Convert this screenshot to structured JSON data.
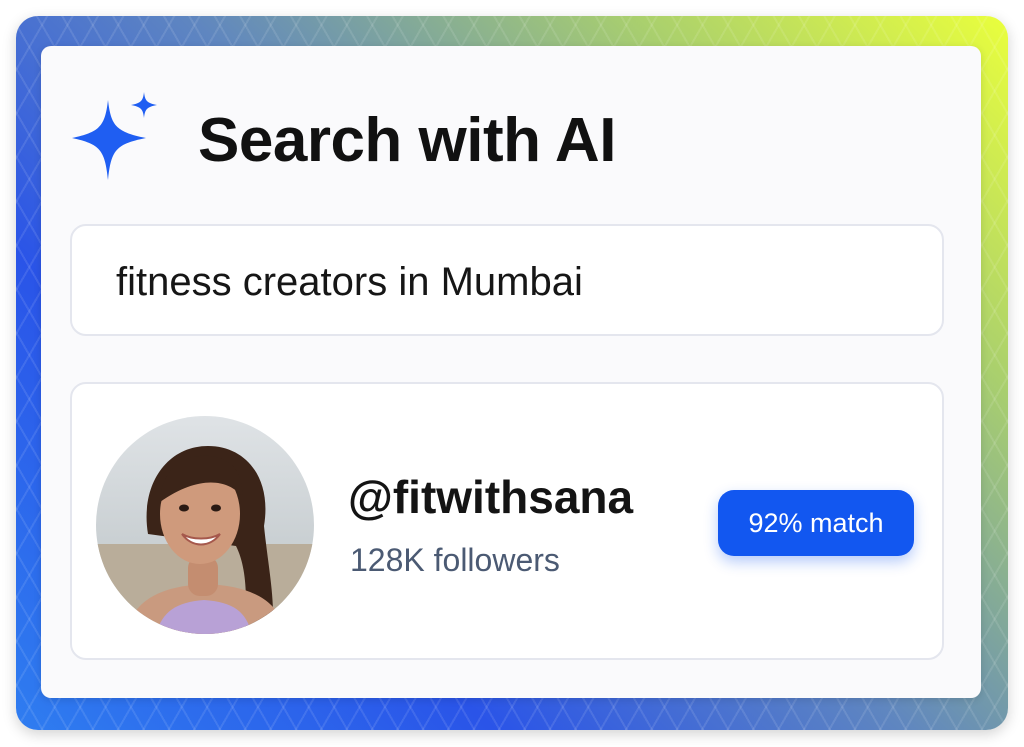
{
  "header": {
    "title": "Search with AI",
    "icon": "sparkle-icon",
    "accent_color": "#1f5ef2"
  },
  "search": {
    "query": "fitness creators in Mumbai"
  },
  "result": {
    "handle": "@fitwithsana",
    "followers": "128K followers",
    "match": "92% match",
    "match_percent": 92,
    "badge_color": "#1257f0"
  }
}
